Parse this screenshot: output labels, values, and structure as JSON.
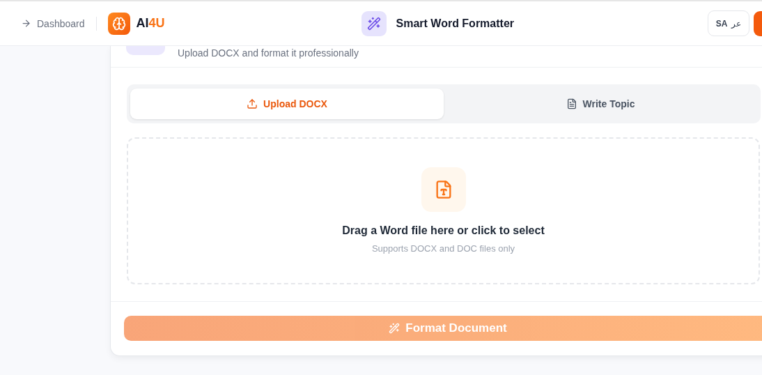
{
  "header": {
    "back_link": "Dashboard",
    "logo": {
      "text_main": "AI",
      "text_accent": "4U"
    },
    "title": "Smart Word Formatter",
    "language_button": {
      "code": "SA",
      "label": "عر"
    }
  },
  "card": {
    "subtitle": "Upload DOCX and format it professionally",
    "tabs": [
      {
        "label": "Upload DOCX",
        "selected": true
      },
      {
        "label": "Write Topic",
        "selected": false
      }
    ],
    "dropzone": {
      "title": "Drag a Word file here or click to select",
      "hint": "Supports DOCX and DOC files only"
    },
    "submit_button": {
      "label": "Format Document",
      "disabled": true
    }
  }
}
